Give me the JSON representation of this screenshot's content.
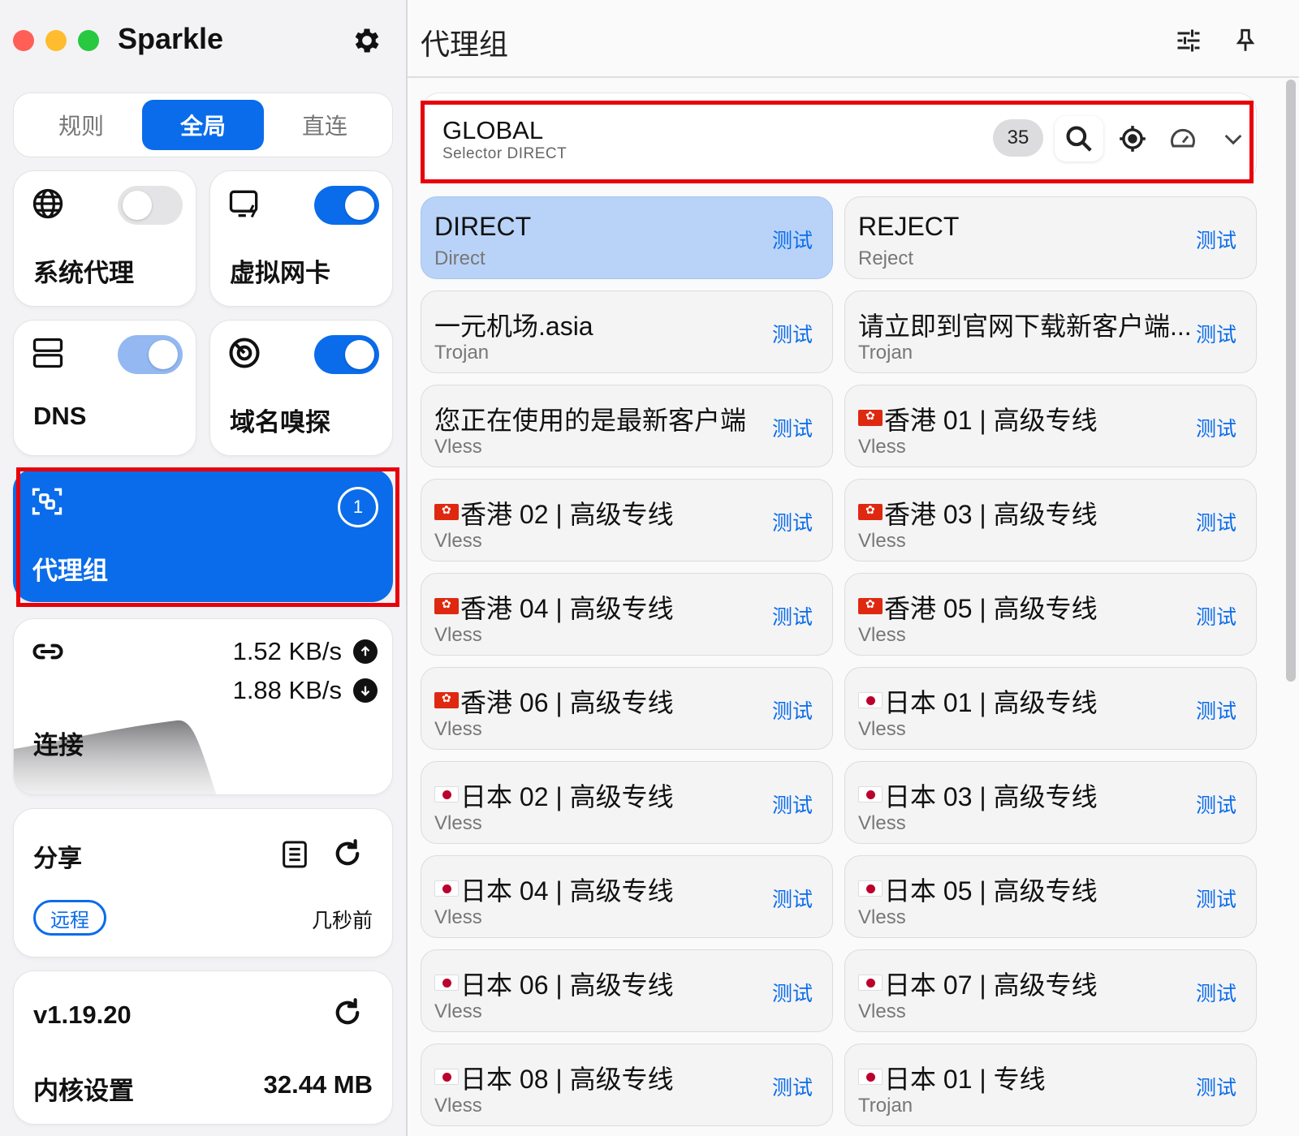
{
  "app": {
    "title": "Sparkle"
  },
  "mode_tabs": [
    {
      "label": "规则",
      "active": false
    },
    {
      "label": "全局",
      "active": true
    },
    {
      "label": "直连",
      "active": false
    }
  ],
  "cards": {
    "system_proxy": {
      "label": "系统代理",
      "icon": "globe-icon",
      "enabled": false
    },
    "virtual_nic": {
      "label": "虚拟网卡",
      "icon": "screen-lightning-icon",
      "enabled": true
    },
    "dns": {
      "label": "DNS",
      "icon": "server-icon",
      "enabled": true
    },
    "sniffer": {
      "label": "域名嗅探",
      "icon": "sniff-icon",
      "enabled": true
    },
    "proxy_group": {
      "label": "代理组",
      "count": "1",
      "icon": "scan-icon"
    },
    "connections": {
      "label": "连接",
      "upload": "1.52 KB/s",
      "download": "1.88 KB/s",
      "icon": "link-icon"
    },
    "share": {
      "label": "分享",
      "badge": "远程",
      "time": "几秒前"
    },
    "core": {
      "version": "v1.19.20",
      "label": "内核设置",
      "memory": "32.44 MB"
    }
  },
  "colors": {
    "accent": "#0a6cea",
    "highlight": "#e8000b",
    "selected_card": "#b9d3f8"
  },
  "main": {
    "title": "代理组",
    "group": {
      "name": "GLOBAL",
      "sub": "Selector  DIRECT",
      "count": "35"
    },
    "test_label": "测试",
    "proxies": [
      {
        "flag": "",
        "name": "DIRECT",
        "type": "Direct",
        "selected": true
      },
      {
        "flag": "",
        "name": "REJECT",
        "type": "Reject",
        "selected": false
      },
      {
        "flag": "",
        "name": "一元机场.asia",
        "type": "Trojan",
        "selected": false
      },
      {
        "flag": "",
        "name": "请立即到官网下载新客户端...",
        "type": "Trojan",
        "selected": false
      },
      {
        "flag": "",
        "name": "您正在使用的是最新客户端",
        "type": "Vless",
        "selected": false
      },
      {
        "flag": "hk",
        "name": "香港 01 | 高级专线",
        "type": "Vless",
        "selected": false
      },
      {
        "flag": "hk",
        "name": "香港 02 | 高级专线",
        "type": "Vless",
        "selected": false
      },
      {
        "flag": "hk",
        "name": "香港 03 | 高级专线",
        "type": "Vless",
        "selected": false
      },
      {
        "flag": "hk",
        "name": "香港 04 | 高级专线",
        "type": "Vless",
        "selected": false
      },
      {
        "flag": "hk",
        "name": "香港 05 | 高级专线",
        "type": "Vless",
        "selected": false
      },
      {
        "flag": "hk",
        "name": "香港 06 | 高级专线",
        "type": "Vless",
        "selected": false
      },
      {
        "flag": "jp",
        "name": "日本 01 | 高级专线",
        "type": "Vless",
        "selected": false
      },
      {
        "flag": "jp",
        "name": "日本 02 | 高级专线",
        "type": "Vless",
        "selected": false
      },
      {
        "flag": "jp",
        "name": "日本 03 | 高级专线",
        "type": "Vless",
        "selected": false
      },
      {
        "flag": "jp",
        "name": "日本 04 | 高级专线",
        "type": "Vless",
        "selected": false
      },
      {
        "flag": "jp",
        "name": "日本 05 | 高级专线",
        "type": "Vless",
        "selected": false
      },
      {
        "flag": "jp",
        "name": "日本 06 | 高级专线",
        "type": "Vless",
        "selected": false
      },
      {
        "flag": "jp",
        "name": "日本 07 | 高级专线",
        "type": "Vless",
        "selected": false
      },
      {
        "flag": "jp",
        "name": "日本 08 | 高级专线",
        "type": "Vless",
        "selected": false
      },
      {
        "flag": "jp",
        "name": "日本 01 | 专线",
        "type": "Trojan",
        "selected": false
      }
    ]
  }
}
